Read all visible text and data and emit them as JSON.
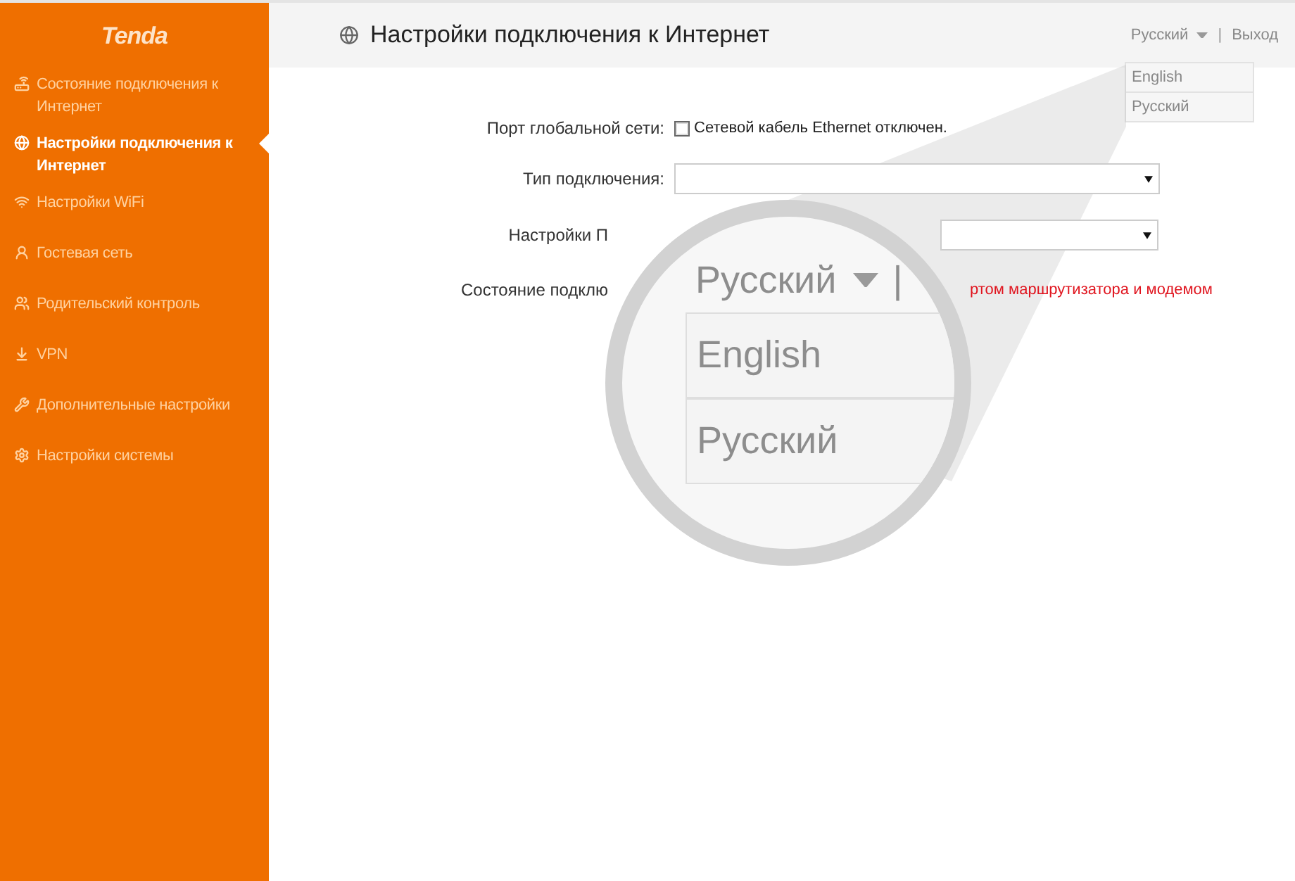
{
  "sidebar": {
    "logo": "Tenda",
    "items": [
      {
        "label": "Состояние подключения к Интернет",
        "selected": false
      },
      {
        "label": "Настройки подключения к Интернет",
        "selected": true
      },
      {
        "label": "Настройки WiFi",
        "selected": false
      },
      {
        "label": "Гостевая сеть",
        "selected": false
      },
      {
        "label": "Родительский контроль",
        "selected": false
      },
      {
        "label": "VPN",
        "selected": false
      },
      {
        "label": "Дополнительные настройки",
        "selected": false
      },
      {
        "label": "Настройки системы",
        "selected": false
      }
    ]
  },
  "header": {
    "title": "Настройки подключения к Интернет",
    "language": "Русский",
    "separator": "|",
    "logout": "Выход",
    "language_options": [
      "English",
      "Русский"
    ]
  },
  "form": [
    {
      "kind": "checkbox",
      "label": "Порт глобальной сети:",
      "value": "Сетевой кабель Ethernet отключен.",
      "checked": false
    },
    {
      "kind": "select",
      "label": "Тип подключения:"
    },
    {
      "kind": "partial_select",
      "label": "Настройки П"
    },
    {
      "kind": "partial_status",
      "label": "Состояние подклю",
      "value": "ртом маршрутизатора и модемом"
    }
  ],
  "magnifier": {
    "language": "Русский",
    "separator": "|",
    "options": [
      "English",
      "Русский"
    ]
  }
}
